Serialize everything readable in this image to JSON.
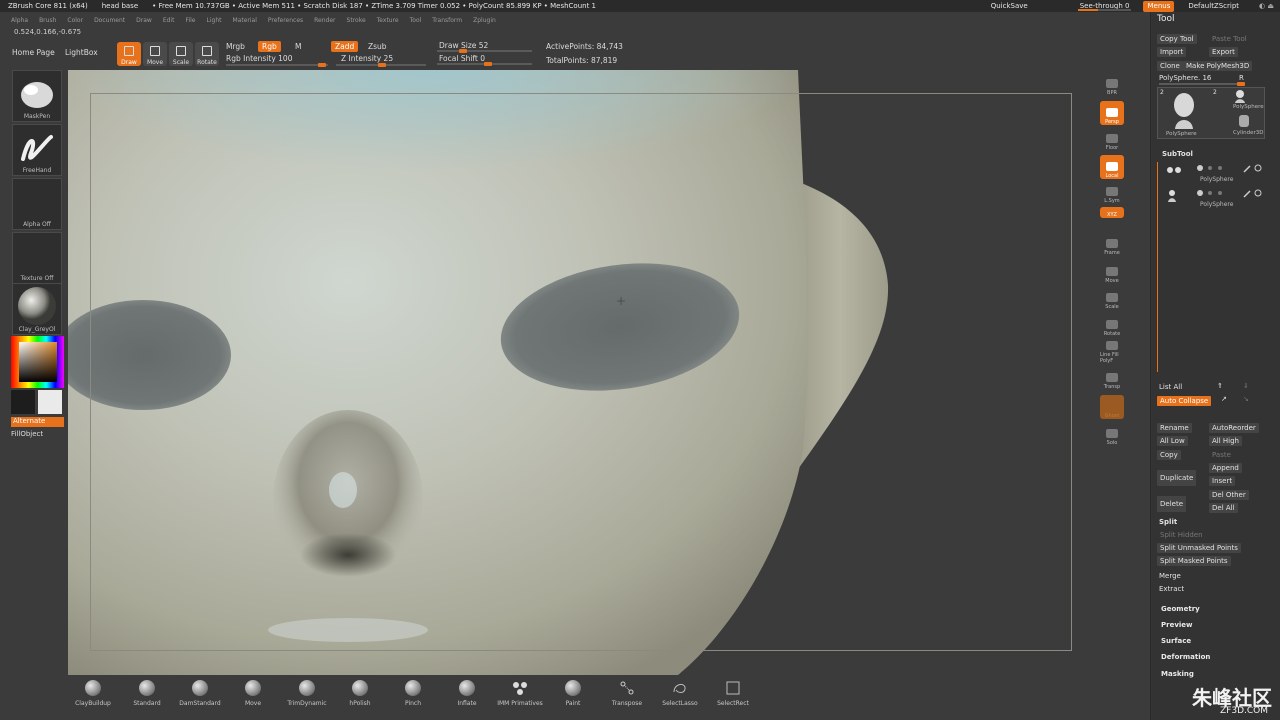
{
  "titlebar": {
    "app": "ZBrush Core 811 (x64)",
    "doc": "head base",
    "stats": "• Free Mem 10.737GB • Active Mem 511 • Scratch Disk 187 • ZTime 3.709 Timer 0.052 • PolyCount 85.899 KP • MeshCount 1",
    "quicksave": "QuickSave",
    "seethrough": "See-through 0",
    "seethrough_value": 0,
    "menus": "Menus",
    "script": "DefaultZScript"
  },
  "menubar": [
    "Alpha",
    "Brush",
    "Color",
    "Document",
    "Draw",
    "Edit",
    "File",
    "Light",
    "Material",
    "Preferences",
    "Render",
    "Stroke",
    "Texture",
    "Tool",
    "Transform",
    "Zplugin"
  ],
  "coords": "0.524,0.166,-0.675",
  "toolbar": {
    "home": "Home Page",
    "lightbox": "LightBox",
    "modes": [
      "Draw",
      "Move",
      "Scale",
      "Rotate"
    ],
    "mrgb": "Mrgb",
    "rgb": "Rgb",
    "m": "M",
    "rgb_intensity": "Rgb Intensity 100",
    "zadd": "Zadd",
    "zsub": "Zsub",
    "z_intensity": "Z Intensity 25",
    "draw_size": "Draw Size 52",
    "focal_shift": "Focal Shift 0",
    "active_points": "ActivePoints: 84,743",
    "total_points": "TotalPoints: 87,819"
  },
  "leftshelf": {
    "brush": "MaskPen",
    "stroke": "FreeHand",
    "alpha": "Alpha Off",
    "texture": "Texture Off",
    "material": "Clay_GreyOl",
    "alternate": "Alternate",
    "fillobject": "FillObject",
    "colors": {
      "main": "#1d1d1d",
      "secondary": "#eaeaea"
    }
  },
  "rightstrip": [
    "BPR",
    "Persp",
    "Floor",
    "Local",
    "L.Sym",
    "XYZ",
    "Frame",
    "Move",
    "Scale",
    "Rotate",
    "Line Fill PolyF",
    "Transp",
    "Ghost",
    "Solo"
  ],
  "toolpanel": {
    "title": "Tool",
    "copy_tool": "Copy Tool",
    "paste_tool": "Paste Tool",
    "import": "Import",
    "export": "Export",
    "clone": "Clone",
    "make_polymesh": "Make PolyMesh3D",
    "current": "PolySphere. 16",
    "r": "R",
    "thumbs": [
      {
        "count": "2",
        "label": "PolySphere"
      },
      {
        "count": "2",
        "label": "PolySphere"
      },
      {
        "count": "",
        "label": "Cylinder3D"
      }
    ],
    "subtool": "SubTool",
    "subtools": [
      "PolySphere",
      "PolySphere"
    ],
    "list_all": "List All",
    "auto_collapse": "Auto Collapse",
    "rename": "Rename",
    "autoreorder": "AutoReorder",
    "all_low": "All Low",
    "all_high": "All High",
    "copy": "Copy",
    "paste": "Paste",
    "duplicate": "Duplicate",
    "append": "Append",
    "insert": "Insert",
    "delete": "Delete",
    "del_other": "Del Other",
    "del_all": "Del All",
    "split": "Split",
    "split_hidden": "Split Hidden",
    "split_unmasked": "Split Unmasked Points",
    "split_masked": "Split Masked Points",
    "merge": "Merge",
    "extract": "Extract",
    "sections": [
      "Geometry",
      "Preview",
      "Surface",
      "Deformation",
      "Masking"
    ]
  },
  "brushes": [
    "ClayBuildup",
    "Standard",
    "DamStandard",
    "Move",
    "TrimDynamic",
    "hPolish",
    "Pinch",
    "Inflate",
    "IMM Primatives",
    "Paint",
    "Transpose",
    "SelectLasso",
    "SelectRect"
  ],
  "watermark": {
    "title": "朱峰社区",
    "url": "ZF3D.COM"
  }
}
